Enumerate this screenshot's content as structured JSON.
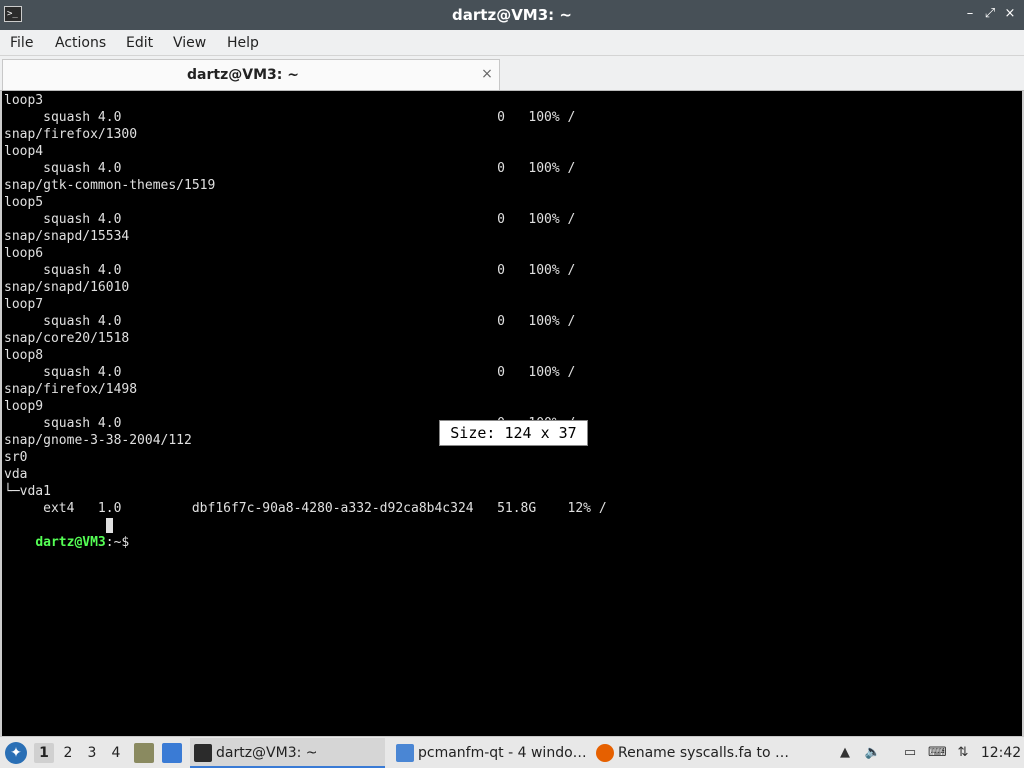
{
  "window": {
    "title": "dartz@VM3: ~",
    "controls": {
      "minimize": "–",
      "maximize": "⤢",
      "close": "×"
    }
  },
  "menu": [
    "File",
    "Actions",
    "Edit",
    "View",
    "Help"
  ],
  "tab": {
    "label": "dartz@VM3: ~",
    "close": "×"
  },
  "terminal": {
    "lines": [
      "loop3",
      "     squash 4.0                                                0   100% /",
      "snap/firefox/1300",
      "loop4",
      "     squash 4.0                                                0   100% /",
      "snap/gtk-common-themes/1519",
      "loop5",
      "     squash 4.0                                                0   100% /",
      "snap/snapd/15534",
      "loop6",
      "     squash 4.0                                                0   100% /",
      "snap/snapd/16010",
      "loop7",
      "     squash 4.0                                                0   100% /",
      "snap/core20/1518",
      "loop8",
      "     squash 4.0                                                0   100% /",
      "snap/firefox/1498",
      "loop9",
      "     squash 4.0                                                0   100% /",
      "snap/gnome-3-38-2004/112",
      "sr0",
      "vda",
      "└─vda1",
      "     ext4   1.0         dbf16f7c-90a8-4280-a332-d92ca8b4c324   51.8G    12% /"
    ],
    "prompt_user": "dartz@VM3",
    "prompt_rest": ":~$ ",
    "size_tooltip": "Size: 124 x 37"
  },
  "taskbar": {
    "desktops": [
      "1",
      "2",
      "3",
      "4"
    ],
    "active_desktop": "1",
    "tasks": [
      {
        "label": "dartz@VM3: ~",
        "active": true
      },
      {
        "label": "pcmanfm-qt - 4 windo…",
        "active": false
      },
      {
        "label": "Rename syscalls.fa to …",
        "active": false
      }
    ],
    "clock": "12:42"
  },
  "colors": {
    "titlebar": "#475057",
    "prompt": "#55ff55",
    "terminal_bg": "#000000",
    "accent": "#3a7bd5"
  }
}
